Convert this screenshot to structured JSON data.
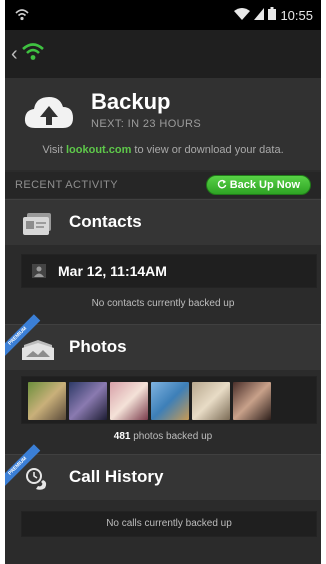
{
  "status_bar": {
    "time": "10:55"
  },
  "header": {
    "title": "Backup",
    "next_backup": "NEXT: IN 23 HOURS",
    "visit_prefix": "Visit ",
    "visit_link": "lookout.com",
    "visit_suffix": " to view or download your data."
  },
  "recent_activity": {
    "label": "RECENT ACTIVITY",
    "backup_button": "Back Up Now"
  },
  "contacts": {
    "title": "Contacts",
    "last_backup": "Mar 12, 11:14AM",
    "note": "No contacts currently backed up"
  },
  "photos": {
    "title": "Photos",
    "count": "481",
    "note_suffix": " photos backed up",
    "ribbon": "PREMIUM"
  },
  "call_history": {
    "title": "Call History",
    "note": "No calls currently backed up",
    "ribbon": "PREMIUM"
  },
  "colors": {
    "accent_green": "#5ec84a",
    "premium_blue": "#3b7fd6"
  }
}
